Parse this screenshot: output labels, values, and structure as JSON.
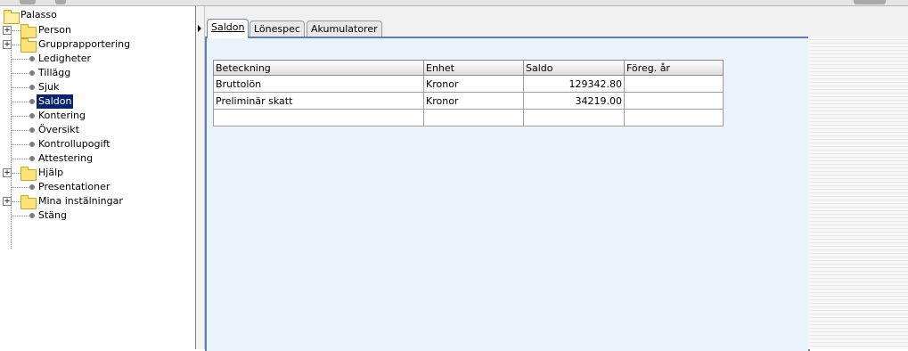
{
  "tree": {
    "root": "Palasso",
    "items": [
      {
        "label": "Person",
        "type": "folder"
      },
      {
        "label": "Grupprapportering",
        "type": "folder"
      },
      {
        "label": "Ledigheter",
        "type": "leaf"
      },
      {
        "label": "Tillägg",
        "type": "leaf"
      },
      {
        "label": "Sjuk",
        "type": "leaf"
      },
      {
        "label": "Saldon",
        "type": "leaf",
        "selected": true
      },
      {
        "label": "Kontering",
        "type": "leaf"
      },
      {
        "label": "Översikt",
        "type": "leaf"
      },
      {
        "label": "Kontrollupogift",
        "type": "leaf"
      },
      {
        "label": "Attestering",
        "type": "leaf"
      },
      {
        "label": "Hjälp",
        "type": "folder"
      },
      {
        "label": "Presentationer",
        "type": "leaf"
      },
      {
        "label": "Mina instälningar",
        "type": "folder"
      },
      {
        "label": "Stäng",
        "type": "leaf"
      }
    ]
  },
  "tabs": [
    {
      "label": "Saldon",
      "active": true
    },
    {
      "label": "Lönespec",
      "active": false
    },
    {
      "label": "Akumulatorer",
      "active": false
    }
  ],
  "grid": {
    "columns": [
      "Beteckning",
      "Enhet",
      "Saldo",
      "Föreg. år"
    ],
    "rows": [
      [
        "Bruttolön",
        "Kronor",
        "129342.80",
        ""
      ],
      [
        "Preliminär skatt",
        "Kronor",
        "34219.00",
        ""
      ],
      [
        "",
        "",
        "",
        ""
      ]
    ]
  },
  "colors": {
    "selection": "#0a246a",
    "tab_border_active": "#6e86b5",
    "content_border": "#5c7fb0",
    "folder": "#ffe27a"
  }
}
